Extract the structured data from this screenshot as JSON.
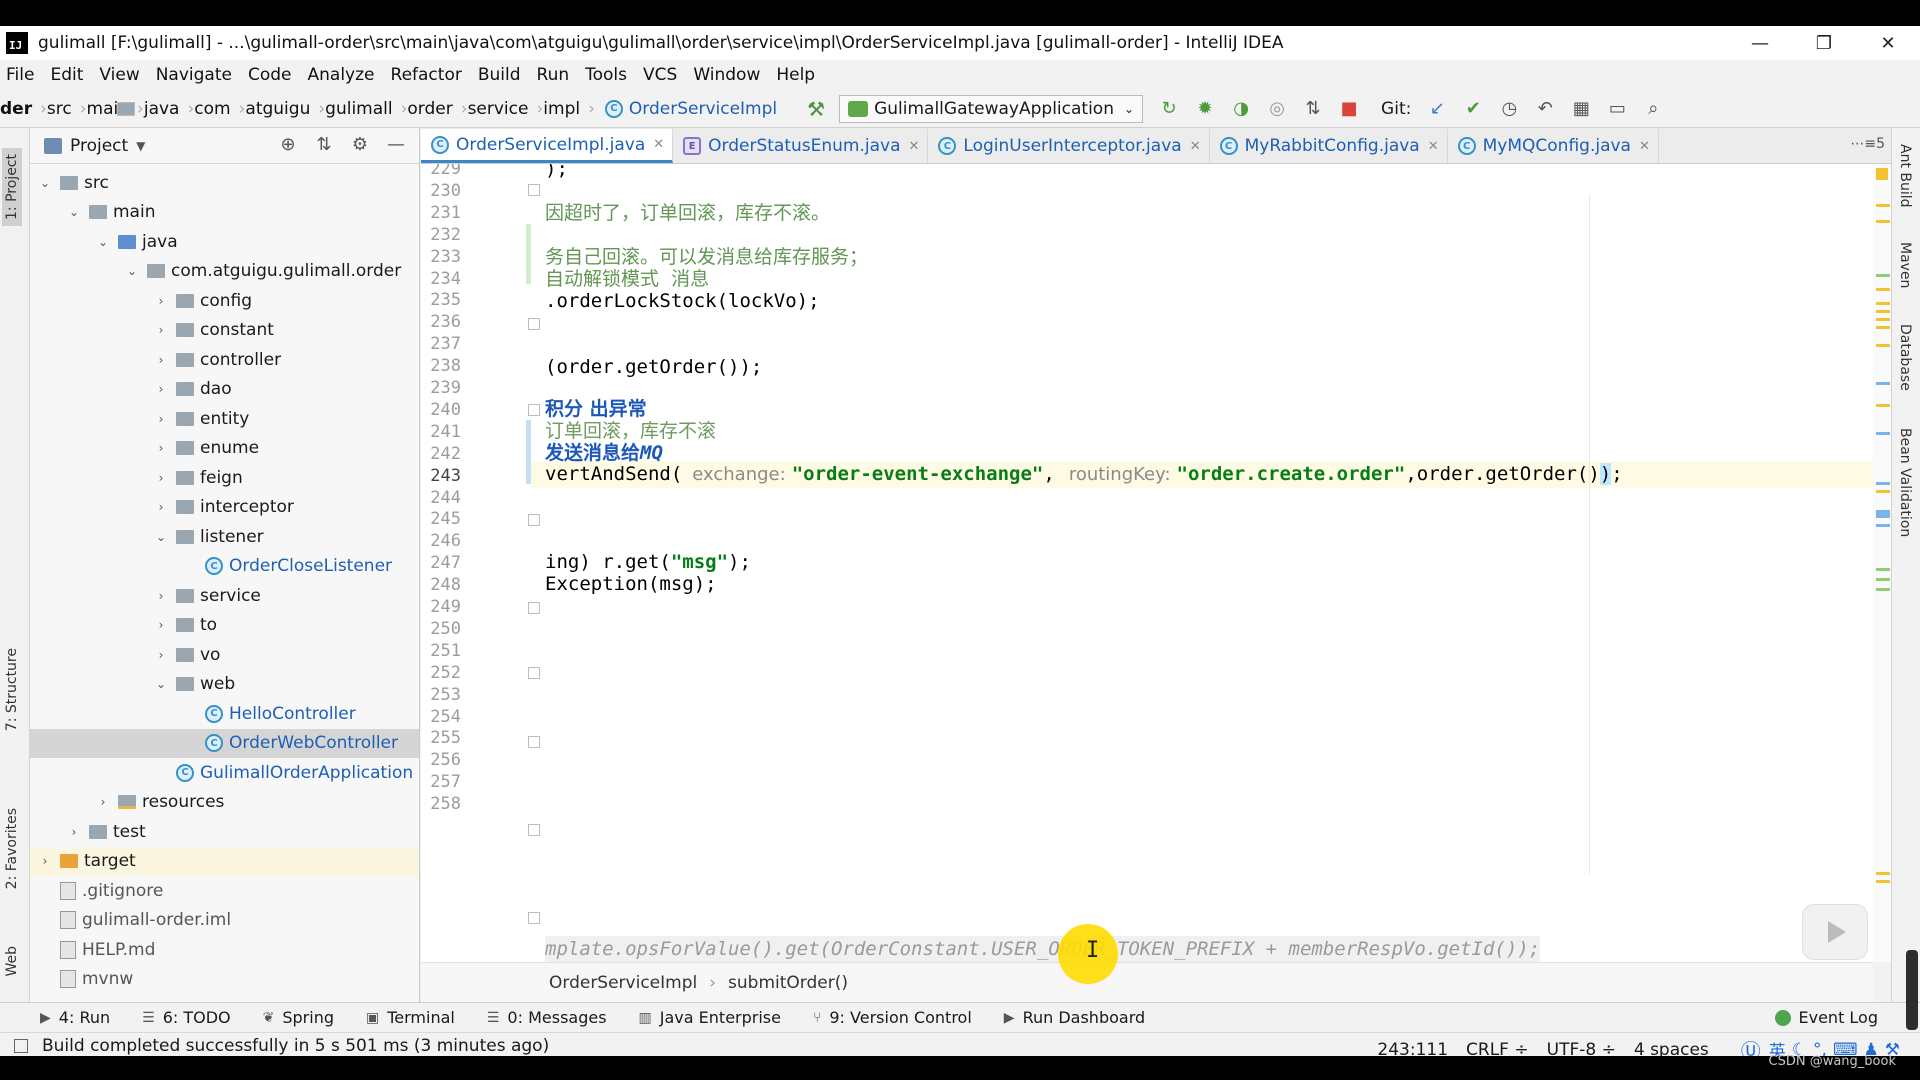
{
  "window": {
    "title": "gulimall [F:\\gulimall] - ...\\gulimall-order\\src\\main\\java\\com\\atguigu\\gulimall\\order\\service\\impl\\OrderServiceImpl.java [gulimall-order] - IntelliJ IDEA",
    "logo_text": "IJ",
    "minimize": "—",
    "restore": "❐",
    "close": "✕"
  },
  "menu": [
    "File",
    "Edit",
    "View",
    "Navigate",
    "Code",
    "Analyze",
    "Refactor",
    "Build",
    "Run",
    "Tools",
    "VCS",
    "Window",
    "Help"
  ],
  "nav": {
    "crumbs": [
      "der",
      "src",
      "main",
      "java",
      "com",
      "atguigu",
      "gulimall",
      "order",
      "service",
      "impl"
    ],
    "class_crumb": "OrderServiceImpl",
    "run_config": "GulimallGatewayApplication",
    "git_label": "Git:"
  },
  "left_stripe": {
    "project": "1: Project",
    "structure": "7: Structure",
    "favorites": "2: Favorites",
    "web": "Web"
  },
  "project_panel": {
    "title": "Project",
    "tree": [
      {
        "label": "src",
        "indent": 0,
        "arrow": "⌄",
        "icon": "folder"
      },
      {
        "label": "main",
        "indent": 1,
        "arrow": "⌄",
        "icon": "folder"
      },
      {
        "label": "java",
        "indent": 2,
        "arrow": "⌄",
        "icon": "folder-blue"
      },
      {
        "label": "com.atguigu.gulimall.order",
        "indent": 3,
        "arrow": "⌄",
        "icon": "package"
      },
      {
        "label": "config",
        "indent": 4,
        "arrow": "›",
        "icon": "package"
      },
      {
        "label": "constant",
        "indent": 4,
        "arrow": "›",
        "icon": "package"
      },
      {
        "label": "controller",
        "indent": 4,
        "arrow": "›",
        "icon": "package"
      },
      {
        "label": "dao",
        "indent": 4,
        "arrow": "›",
        "icon": "package"
      },
      {
        "label": "entity",
        "indent": 4,
        "arrow": "›",
        "icon": "package"
      },
      {
        "label": "enume",
        "indent": 4,
        "arrow": "›",
        "icon": "package"
      },
      {
        "label": "feign",
        "indent": 4,
        "arrow": "›",
        "icon": "package"
      },
      {
        "label": "interceptor",
        "indent": 4,
        "arrow": "›",
        "icon": "package"
      },
      {
        "label": "listener",
        "indent": 4,
        "arrow": "⌄",
        "icon": "package"
      },
      {
        "label": "OrderCloseListener",
        "indent": 5,
        "arrow": "",
        "icon": "class"
      },
      {
        "label": "service",
        "indent": 4,
        "arrow": "›",
        "icon": "package"
      },
      {
        "label": "to",
        "indent": 4,
        "arrow": "›",
        "icon": "package"
      },
      {
        "label": "vo",
        "indent": 4,
        "arrow": "›",
        "icon": "package"
      },
      {
        "label": "web",
        "indent": 4,
        "arrow": "⌄",
        "icon": "package"
      },
      {
        "label": "HelloController",
        "indent": 5,
        "arrow": "",
        "icon": "class"
      },
      {
        "label": "OrderWebController",
        "indent": 5,
        "arrow": "",
        "icon": "class",
        "selected": true
      },
      {
        "label": "GulimallOrderApplication",
        "indent": 4,
        "arrow": "",
        "icon": "class"
      },
      {
        "label": "resources",
        "indent": 2,
        "arrow": "›",
        "icon": "resources"
      },
      {
        "label": "test",
        "indent": 1,
        "arrow": "›",
        "icon": "folder"
      },
      {
        "label": "target",
        "indent": 0,
        "arrow": "›",
        "icon": "folder-orange",
        "highlight": true
      },
      {
        "label": ".gitignore",
        "indent": 0,
        "arrow": "",
        "icon": "file"
      },
      {
        "label": "gulimall-order.iml",
        "indent": 0,
        "arrow": "",
        "icon": "file"
      },
      {
        "label": "HELP.md",
        "indent": 0,
        "arrow": "",
        "icon": "file"
      },
      {
        "label": "mvnw",
        "indent": 0,
        "arrow": "",
        "icon": "file"
      }
    ]
  },
  "tabs": [
    {
      "label": "OrderServiceImpl.java",
      "kind": "class",
      "active": true
    },
    {
      "label": "OrderStatusEnum.java",
      "kind": "enum",
      "active": false
    },
    {
      "label": "LoginUserInterceptor.java",
      "kind": "class",
      "active": false
    },
    {
      "label": "MyRabbitConfig.java",
      "kind": "class",
      "active": false
    },
    {
      "label": "MyMQConfig.java",
      "kind": "class",
      "active": false
    }
  ],
  "tabs_more": "⋯≡5",
  "editor": {
    "line_numbers": [
      "229",
      "230",
      "231",
      "232",
      "233",
      "234",
      "235",
      "236",
      "237",
      "238",
      "239",
      "240",
      "241",
      "242",
      "243",
      "244",
      "245",
      "246",
      "247",
      "248",
      "249",
      "250",
      "251",
      "252",
      "253",
      "254",
      "255",
      "256",
      "257",
      "258"
    ],
    "current_line": "243",
    "line_231": "因超时了，订单回滚，库存不滚。",
    "line_233": "务自己回滚。可以发消息给库存服务；",
    "line_234": "自动解锁模式  消息",
    "line_235": ".orderLockStock(lockVo);",
    "line_229": ");",
    "line_238": "(order.getOrder());",
    "line_240": "积分 出异常",
    "line_241": "订单回滚，库存不滚",
    "line_242a": "发送消息给",
    "line_242b": "MQ",
    "line_243": {
      "call": "vertAndSend(",
      "hint1": "exchange:",
      "arg1": "\"order-event-exchange\"",
      "comma1": ",",
      "hint2": "routingKey:",
      "arg2": "\"order.create.order\"",
      "tail_pre": ",order.getOrder()",
      "paren": ")",
      "end": ";"
    },
    "line_247a": "ing) r.get(",
    "line_247b": "\"msg\"",
    "line_247c": ");",
    "line_248": "Exception(msg);",
    "line_258": "mplate.opsForValue().get(OrderConstant.USER_ORDER_TOKEN_PREFIX + memberRespVo.getId());"
  },
  "breadcrumb_bottom": {
    "class": "OrderServiceImpl",
    "method": "submitOrder()"
  },
  "right_stripe": [
    "Ant Build",
    "Maven",
    "Database",
    "Bean Validation"
  ],
  "tool_windows": [
    {
      "icon": "▶",
      "label": "4: Run"
    },
    {
      "icon": "☰",
      "label": "6: TODO"
    },
    {
      "icon": "❦",
      "label": "Spring"
    },
    {
      "icon": "▣",
      "label": "Terminal"
    },
    {
      "icon": "☰",
      "label": "0: Messages"
    },
    {
      "icon": "▥",
      "label": "Java Enterprise"
    },
    {
      "icon": "⑂",
      "label": "9: Version Control"
    },
    {
      "icon": "▶",
      "label": "Run Dashboard"
    }
  ],
  "event_log": "Event Log",
  "status": {
    "message": "Build completed successfully in 5 s 501 ms (3 minutes ago)",
    "position": "243:111",
    "line_sep": "CRLF ÷",
    "encoding": "UTF-8 ÷",
    "indent": "4 spaces",
    "ime": "英"
  },
  "watermark": "CSDN @wang_book",
  "cursor_char": "I"
}
